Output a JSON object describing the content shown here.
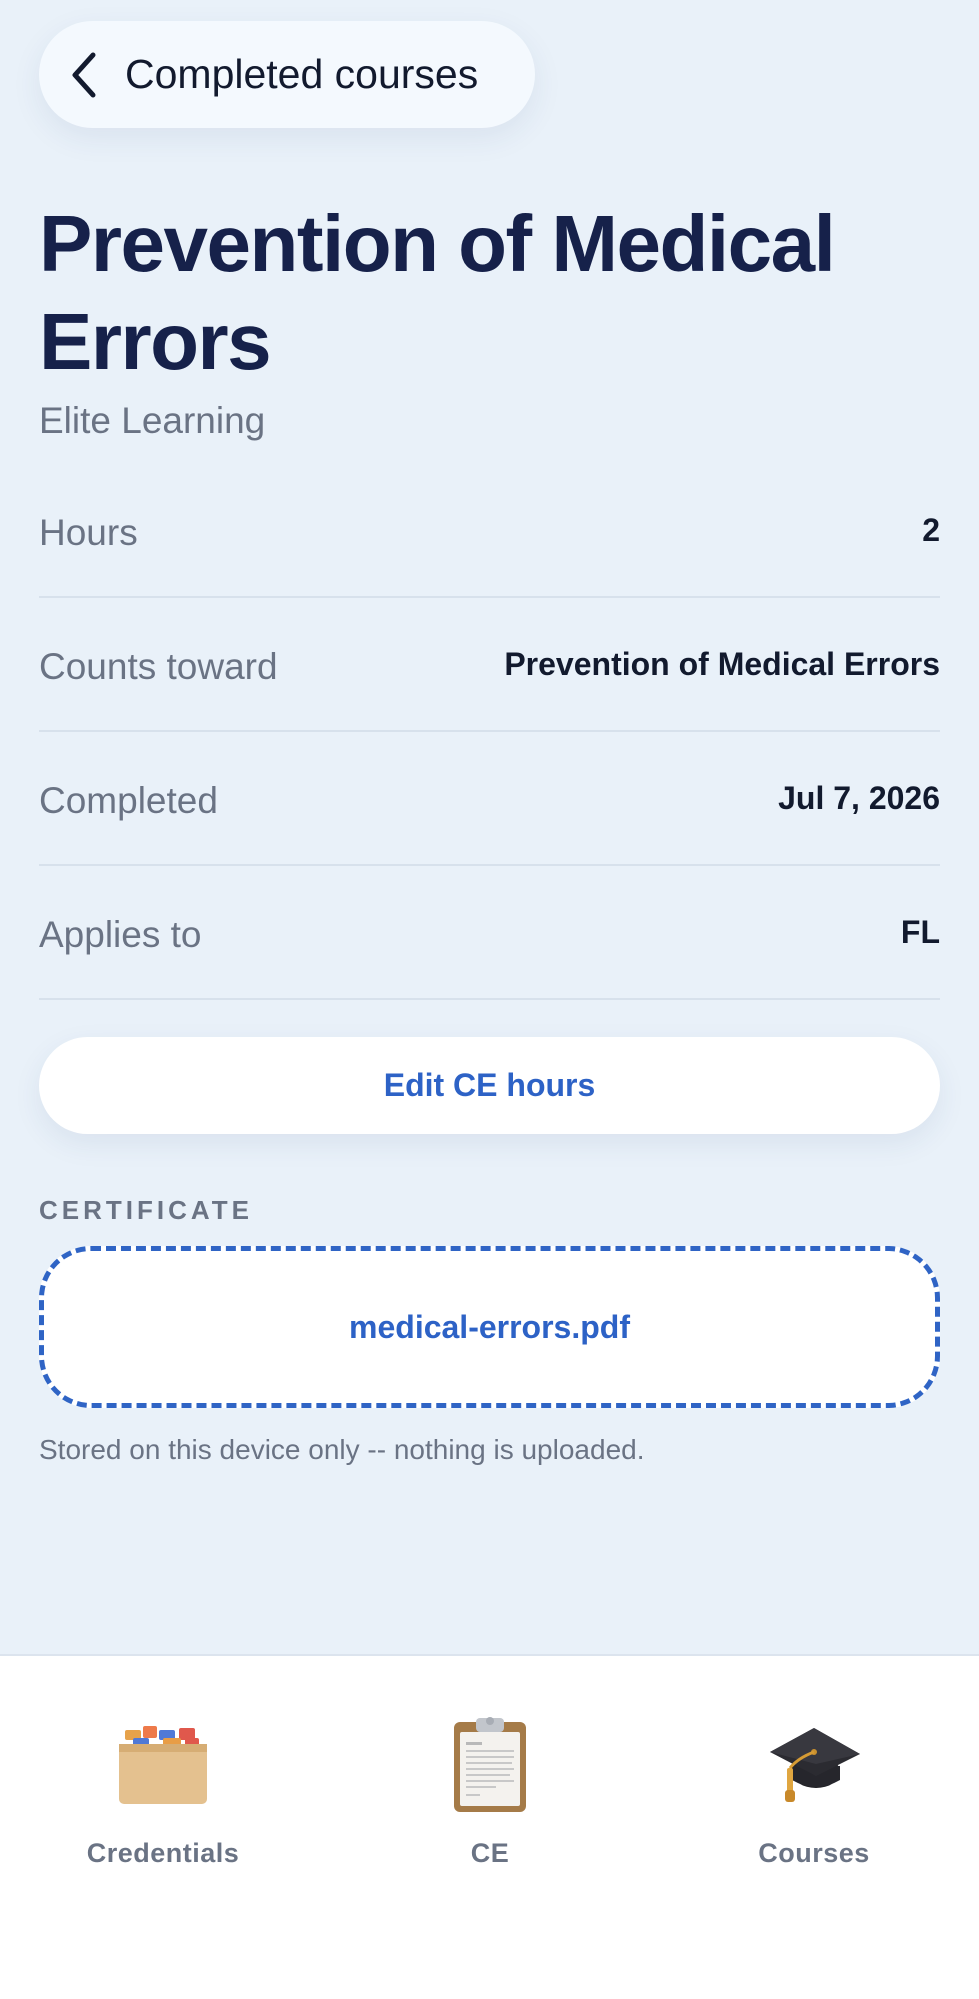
{
  "nav": {
    "back_label": "Completed courses"
  },
  "course": {
    "title": "Prevention of Medical Errors",
    "provider": "Elite Learning"
  },
  "details": [
    {
      "label": "Hours",
      "value": "2"
    },
    {
      "label": "Counts toward",
      "value": "Prevention of Medical Errors"
    },
    {
      "label": "Completed",
      "value": "Jul 7, 2026"
    },
    {
      "label": "Applies to",
      "value": "FL"
    }
  ],
  "actions": {
    "edit_label": "Edit CE hours"
  },
  "certificate": {
    "section_title": "CERTIFICATE",
    "file_name": "medical-errors.pdf",
    "note": "Stored on this device only -- nothing is uploaded."
  },
  "tabs": [
    {
      "label": "Credentials",
      "icon": "card-index-icon"
    },
    {
      "label": "CE",
      "icon": "clipboard-icon"
    },
    {
      "label": "Courses",
      "icon": "graduation-cap-icon"
    }
  ],
  "colors": {
    "background": "#e9f1f9",
    "accent": "#2d62c6",
    "title": "#16214a",
    "muted": "#6a7384"
  }
}
